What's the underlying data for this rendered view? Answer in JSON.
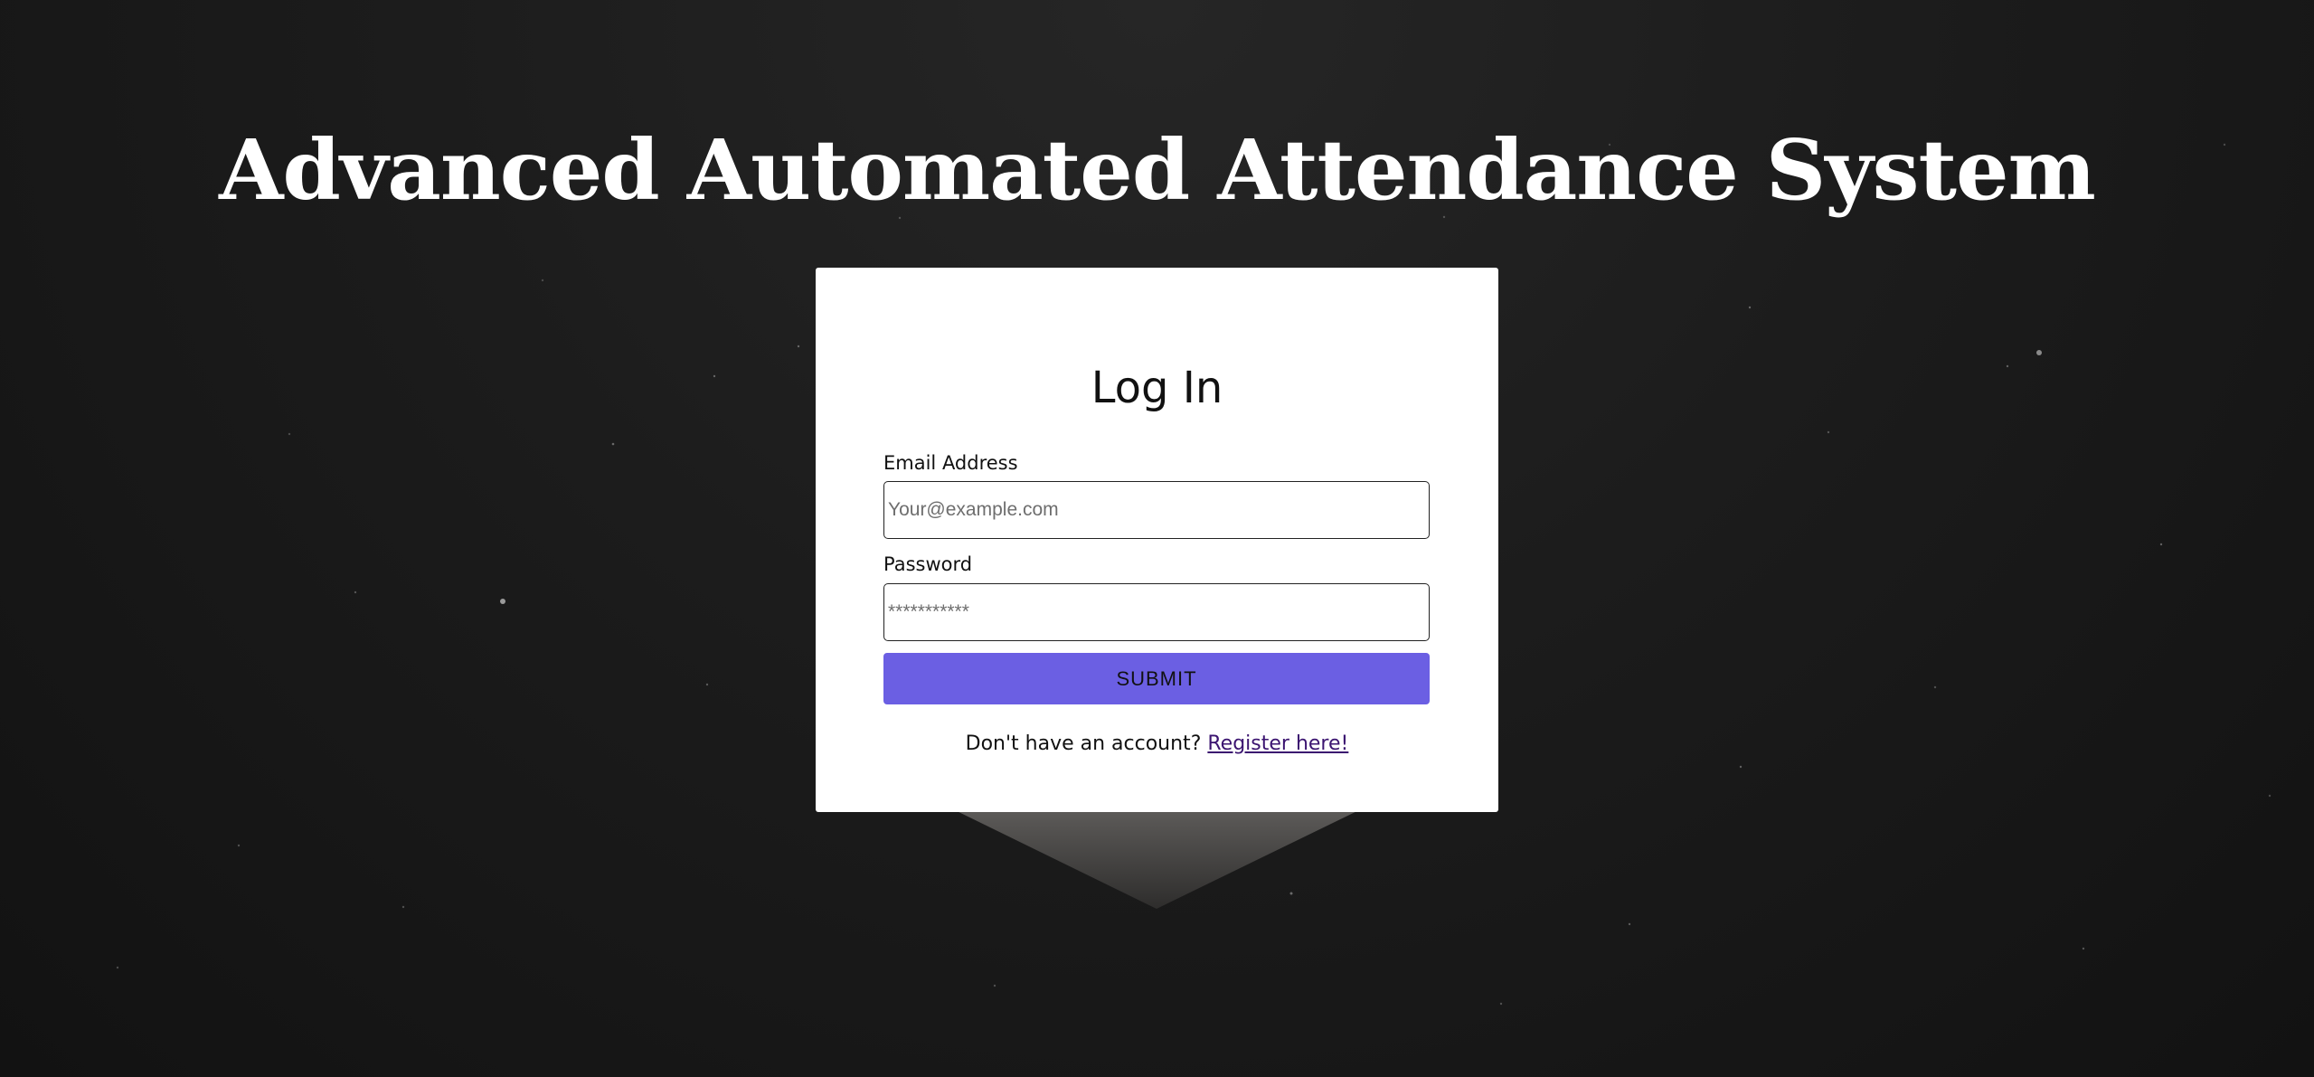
{
  "page": {
    "title": "Advanced Automated Attendance System"
  },
  "login_card": {
    "heading": "Log In",
    "email": {
      "label": "Email Address",
      "placeholder": "Your@example.com",
      "value": ""
    },
    "password": {
      "label": "Password",
      "placeholder": "***********",
      "value": ""
    },
    "submit_label": "SUBMIT",
    "register_prompt": "Don't have an account?",
    "register_link": "Register here!"
  },
  "colors": {
    "background": "#1c1c1c",
    "title_text": "#ffffff",
    "card_background": "#ffffff",
    "submit_button": "#6b5fe3",
    "link": "#3b1470"
  }
}
